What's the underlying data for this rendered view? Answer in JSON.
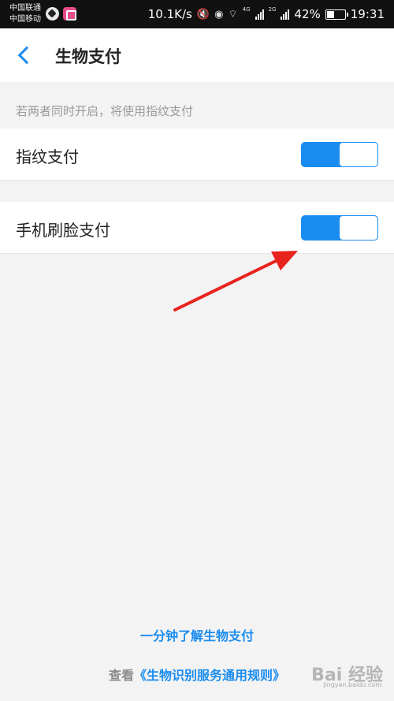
{
  "status_bar": {
    "carrier1": "中国联通",
    "carrier2": "中国移动",
    "speed": "10.1K/s",
    "net1": "4G",
    "net2": "2G",
    "battery": "42%",
    "battery_level": 0.42,
    "time": "19:31"
  },
  "header": {
    "title": "生物支付"
  },
  "hint": "若两者同时开启，将使用指纹支付",
  "settings": [
    {
      "label": "指纹支付",
      "enabled": true
    },
    {
      "label": "手机刷脸支付",
      "enabled": true
    }
  ],
  "footer": {
    "learn_link": "一分钟了解生物支付",
    "rules_prefix": "查看",
    "rules_link": "《生物识别服务通用规则》"
  },
  "watermark": {
    "text": "Bai 经验",
    "sub": "jingyan.baidu.com"
  },
  "colors": {
    "accent": "#1a8cf0",
    "annotation_arrow": "#e8231e"
  }
}
